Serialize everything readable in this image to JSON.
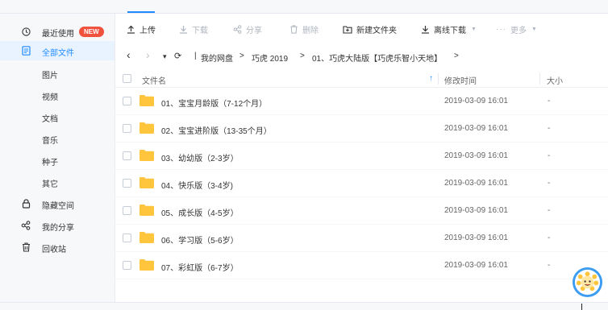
{
  "colors": {
    "accent": "#1f8bff",
    "badge": "#f0523e",
    "folder": "#ffc53d"
  },
  "sidebar": {
    "items": [
      {
        "label": "最近使用",
        "icon": "clock-icon",
        "badge": "NEW"
      },
      {
        "label": "全部文件",
        "icon": "file-list-icon"
      },
      {
        "label": "图片"
      },
      {
        "label": "视频"
      },
      {
        "label": "文档"
      },
      {
        "label": "音乐"
      },
      {
        "label": "种子"
      },
      {
        "label": "其它"
      },
      {
        "label": "隐藏空间",
        "icon": "lock-icon"
      },
      {
        "label": "我的分享",
        "icon": "share-icon"
      },
      {
        "label": "回收站",
        "icon": "trash-icon"
      }
    ]
  },
  "toolbar": {
    "upload": "上传",
    "download": "下载",
    "share": "分享",
    "delete": "删除",
    "new_folder": "新建文件夹",
    "offline_download": "离线下载",
    "more": "更多"
  },
  "pathbar": {
    "back": "‹",
    "forward": "›",
    "dropdown": "▾",
    "refresh": "⟳",
    "crumbs": [
      "我的网盘",
      "巧虎 2019",
      "01、巧虎大陆版【巧虎乐智小天地】"
    ],
    "separator": ">"
  },
  "table": {
    "headers": {
      "name": "文件名",
      "modified": "修改时间",
      "size": "大小"
    },
    "sort_arrow": "↑",
    "rows": [
      {
        "name": "01、宝宝月龄版（7-12个月）",
        "modified": "2019-03-09 16:01",
        "size": "-"
      },
      {
        "name": "02、宝宝进阶版（13-35个月）",
        "modified": "2019-03-09 16:01",
        "size": "-"
      },
      {
        "name": "03、幼幼版（2-3岁）",
        "modified": "2019-03-09 16:01",
        "size": "-"
      },
      {
        "name": "04、快乐版（3-4岁)",
        "modified": "2019-03-09 16:01",
        "size": "-"
      },
      {
        "name": "05、成长版（4-5岁）",
        "modified": "2019-03-09 16:01",
        "size": "-"
      },
      {
        "name": "06、学习版（5-6岁）",
        "modified": "2019-03-09 16:01",
        "size": "-"
      },
      {
        "name": "07、彩虹版（6-7岁）",
        "modified": "2019-03-09 16:01",
        "size": "-"
      }
    ]
  }
}
